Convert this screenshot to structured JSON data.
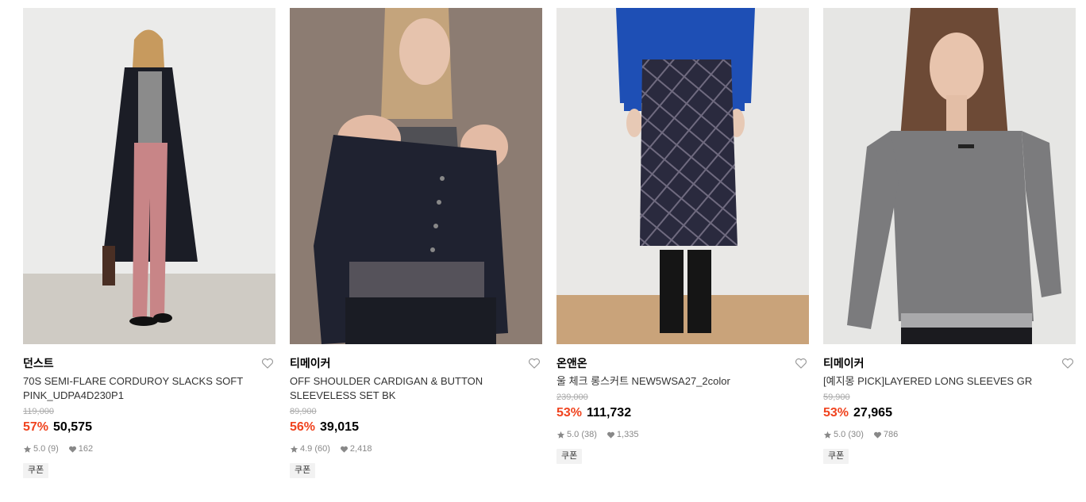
{
  "products": [
    {
      "brand": "던스트",
      "title": "70S SEMI-FLARE CORDUROY SLACKS SOFT PINK_UDPA4D230P1",
      "original_price": "119,000",
      "discount": "57%",
      "price": "50,575",
      "rating": "5.0 (9)",
      "likes": "162",
      "badge": "쿠폰",
      "image_alt": "model in black coat and pink corduroy slacks"
    },
    {
      "brand": "티메이커",
      "title": "OFF SHOULDER CARDIGAN & BUTTON SLEEVELESS SET BK",
      "original_price": "89,900",
      "discount": "56%",
      "price": "39,015",
      "rating": "4.9 (60)",
      "likes": "2,418",
      "badge": "쿠폰",
      "image_alt": "model in black off-shoulder cardigan set"
    },
    {
      "brand": "온앤온",
      "title": "울 체크 롱스커트 NEW5WSA27_2color",
      "original_price": "239,000",
      "discount": "53%",
      "price": "111,732",
      "rating": "5.0 (38)",
      "likes": "1,335",
      "badge": "쿠폰",
      "image_alt": "navy plaid wool long skirt with blue sweater"
    },
    {
      "brand": "티메이커",
      "title": "[예지몽 PICK]LAYERED LONG SLEEVES GR",
      "original_price": "59,900",
      "discount": "53%",
      "price": "27,965",
      "rating": "5.0 (30)",
      "likes": "786",
      "badge": "쿠폰",
      "image_alt": "model in grey layered long sleeve top"
    }
  ],
  "icons": {
    "wishlist": "heart-outline-icon",
    "rating": "star-icon",
    "likes": "heart-filled-icon"
  },
  "colors": {
    "discount": "#f0431e",
    "price": "#000000",
    "muted": "#888888",
    "badge_bg": "#f2f2f2"
  }
}
